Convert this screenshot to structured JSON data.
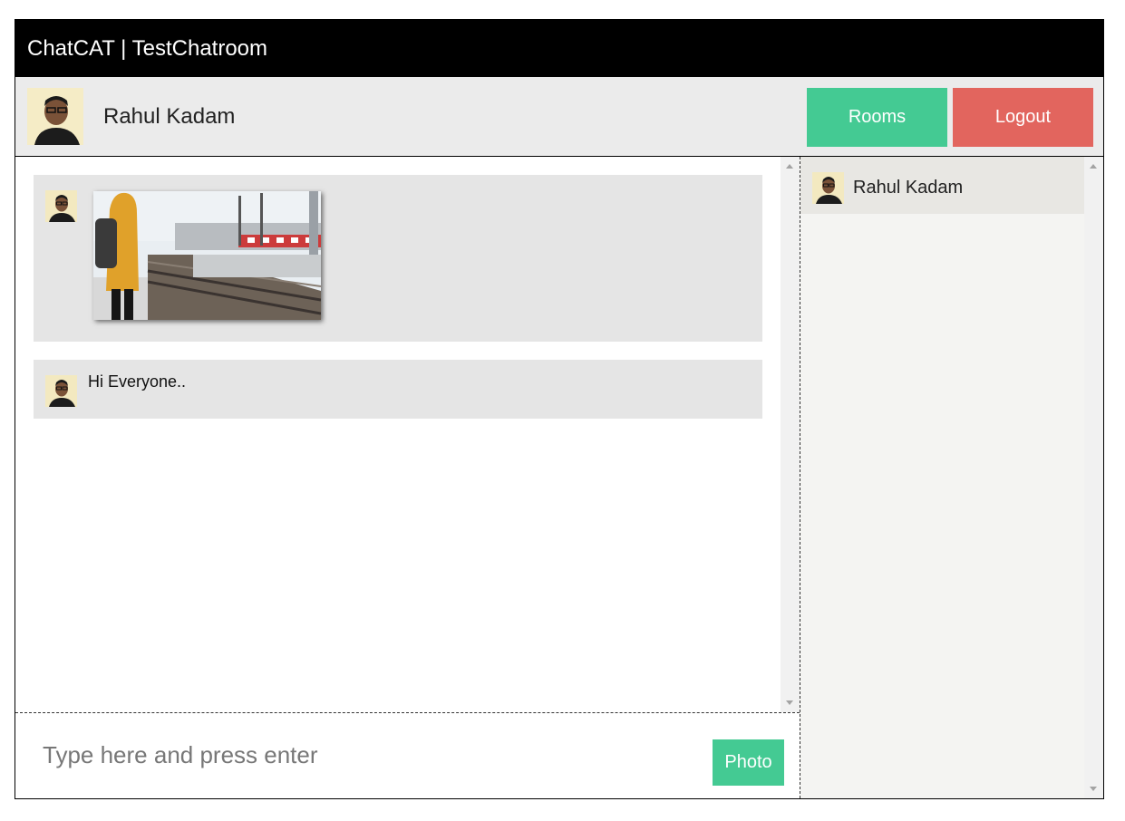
{
  "header": {
    "title": "ChatCAT | TestChatroom"
  },
  "user": {
    "name": "Rahul Kadam",
    "avatar_icon": "user-avatar"
  },
  "buttons": {
    "rooms": "Rooms",
    "logout": "Logout",
    "photo": "Photo"
  },
  "colors": {
    "accent_green": "#44ca93",
    "logout_red": "#e2655e",
    "title_bg": "#000000"
  },
  "messages": [
    {
      "type": "image",
      "image": "photo of a person in a yellow hooded jacket with a backpack on a train platform"
    },
    {
      "type": "text",
      "text": "Hi Everyone.."
    }
  ],
  "composer": {
    "placeholder": "Type here and press enter",
    "value": ""
  },
  "users_list": [
    {
      "name": "Rahul Kadam"
    }
  ]
}
